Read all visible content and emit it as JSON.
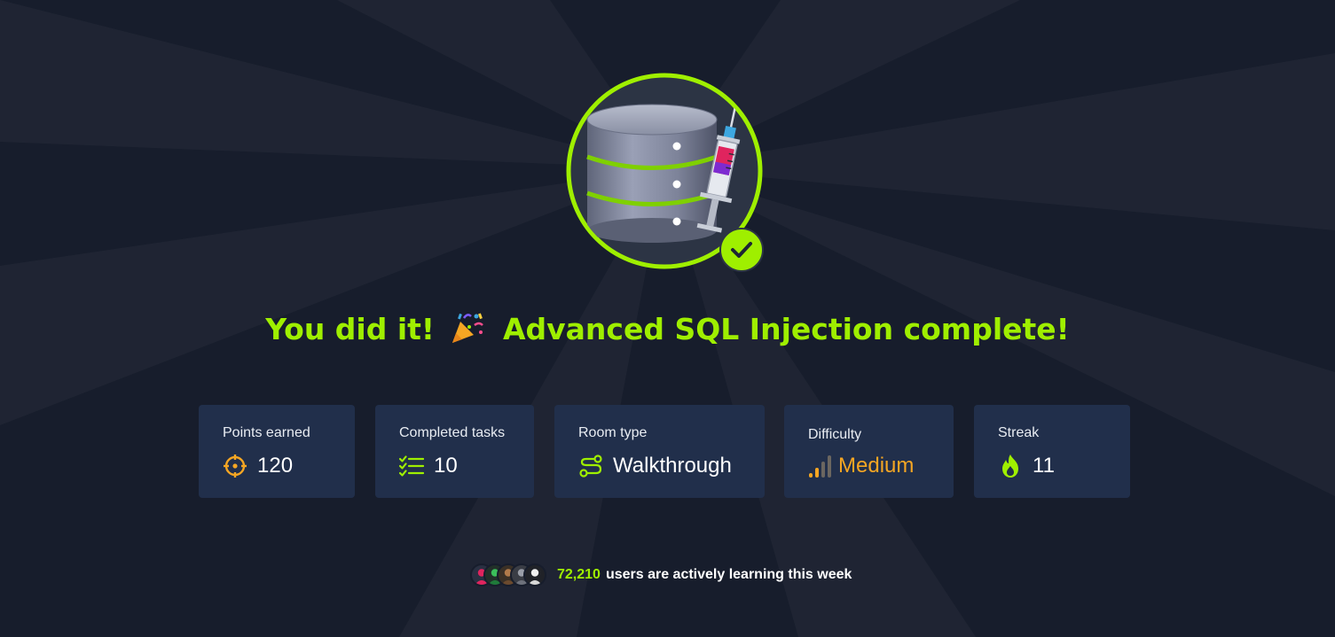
{
  "headline": {
    "before": "You did it!",
    "after": "Advanced SQL Injection complete!",
    "emoji_icon": "party-popper-icon"
  },
  "room_badge": {
    "icon": "database-syringe-icon",
    "completed_icon": "checkmark-icon"
  },
  "stats": [
    {
      "label": "Points earned",
      "value": "120",
      "icon": "crosshair-icon"
    },
    {
      "label": "Completed tasks",
      "value": "10",
      "icon": "task-list-icon"
    },
    {
      "label": "Room type",
      "value": "Walkthrough",
      "icon": "route-icon"
    },
    {
      "label": "Difficulty",
      "value": "Medium",
      "icon": "signal-bars-icon"
    },
    {
      "label": "Streak",
      "value": "11",
      "icon": "flame-icon"
    }
  ],
  "footer": {
    "count": "72,210",
    "message": "users are actively learning this week",
    "avatar_count": 5
  },
  "colors": {
    "background": "#171d2c",
    "accent": "#9fef00",
    "card": "#212f4b",
    "medium": "#f5a623",
    "points_icon": "#f5a623"
  }
}
